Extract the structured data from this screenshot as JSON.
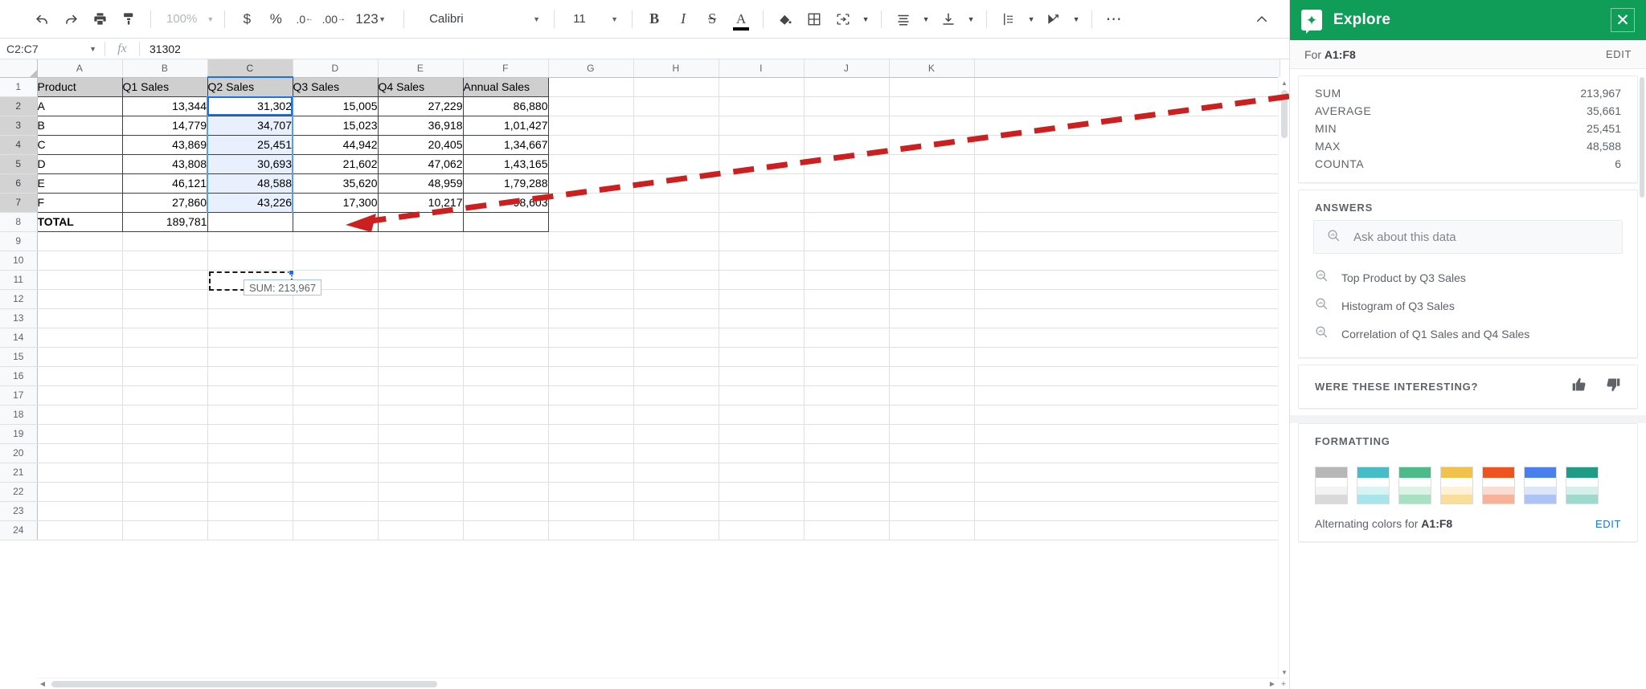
{
  "toolbar": {
    "zoom": "100%",
    "font": "Calibri",
    "font_size": "11",
    "currency_label": "$",
    "percent_label": "%",
    "dec_dec_label": ".0",
    "dec_inc_label": ".00",
    "numfmt_label": "123",
    "bold_label": "B",
    "italic_label": "I",
    "strike_label": "S",
    "textcolor_label": "A",
    "more_label": "⋯",
    "icons": [
      "undo-icon",
      "redo-icon",
      "print-icon",
      "paint-format-icon",
      "fill-color-icon",
      "borders-icon",
      "merge-cells-icon",
      "horizontal-align-icon",
      "vertical-align-icon",
      "text-wrap-icon",
      "text-rotation-icon",
      "collapse-toolbar-icon"
    ]
  },
  "formula_bar": {
    "name_box": "C2:C7",
    "fx": "fx",
    "value": "31302"
  },
  "grid": {
    "columns": [
      "A",
      "B",
      "C",
      "D",
      "E",
      "F",
      "G",
      "H",
      "I",
      "J",
      "K"
    ],
    "selected_column": "C",
    "rows": [
      1,
      2,
      3,
      4,
      5,
      6,
      7,
      8,
      9,
      10,
      11,
      12,
      13,
      14,
      15,
      16,
      17,
      18,
      19,
      20,
      21,
      22,
      23,
      24
    ],
    "selected_rows": [
      2,
      3,
      4,
      5,
      6,
      7
    ],
    "table": {
      "headers": [
        "Product",
        "Q1 Sales",
        "Q2 Sales",
        "Q3 Sales",
        "Q4 Sales",
        "Annual Sales"
      ],
      "rows": [
        [
          "A",
          "13,344",
          "31,302",
          "15,005",
          "27,229",
          "86,880"
        ],
        [
          "B",
          "14,779",
          "34,707",
          "15,023",
          "36,918",
          "1,01,427"
        ],
        [
          "C",
          "43,869",
          "25,451",
          "44,942",
          "20,405",
          "1,34,667"
        ],
        [
          "D",
          "43,808",
          "30,693",
          "21,602",
          "47,062",
          "1,43,165"
        ],
        [
          "E",
          "46,121",
          "48,588",
          "35,620",
          "48,959",
          "1,79,288"
        ],
        [
          "F",
          "27,860",
          "43,226",
          "17,300",
          "10,217",
          "98,603"
        ]
      ],
      "total_row": [
        "TOTAL",
        "189,781",
        "",
        "",
        "",
        ""
      ]
    },
    "sum_tooltip": "SUM: 213,967"
  },
  "explore": {
    "title": "Explore",
    "logo_icon": "explore-star-icon",
    "close_icon": "close-icon",
    "range_prefix": "For",
    "range": "A1:F8",
    "range_edit": "EDIT",
    "stats": [
      {
        "name": "SUM",
        "value": "213,967"
      },
      {
        "name": "AVERAGE",
        "value": "35,661"
      },
      {
        "name": "MIN",
        "value": "25,451"
      },
      {
        "name": "MAX",
        "value": "48,588"
      },
      {
        "name": "COUNTA",
        "value": "6"
      }
    ],
    "answers_title": "ANSWERS",
    "ask_placeholder": "Ask about this data",
    "suggestions": [
      "Top Product by Q3 Sales",
      "Histogram of Q3 Sales",
      "Correlation of Q1 Sales and Q4 Sales"
    ],
    "feedback_label": "WERE THESE INTERESTING?",
    "thumb_up_icon": "thumb-up-icon",
    "thumb_down_icon": "thumb-down-icon",
    "formatting_title": "FORMATTING",
    "swatches": [
      {
        "name": "grey",
        "header": "#b7b7b7",
        "band": "#f3f3f3",
        "band2": "#d9d9d9"
      },
      {
        "name": "cyan",
        "header": "#46bdc6",
        "band": "#d9f2f4",
        "band2": "#a8e4e9"
      },
      {
        "name": "green",
        "header": "#4cbb87",
        "band": "#ddf2e7",
        "band2": "#a9dfc3"
      },
      {
        "name": "yellow",
        "header": "#f2c14b",
        "band": "#fdf2d5",
        "band2": "#f8dd9b"
      },
      {
        "name": "red",
        "header": "#ef5420",
        "band": "#fbdcd1",
        "band2": "#f8b29a"
      },
      {
        "name": "blue",
        "header": "#4a80ee",
        "band": "#dde5fa",
        "band2": "#adc3f6"
      },
      {
        "name": "teal",
        "header": "#1f9b86",
        "band": "#d7efe9",
        "band2": "#9fd9ce"
      }
    ],
    "alternating_prefix": "Alternating colors for",
    "alternating_range": "A1:F8",
    "alternating_edit": "EDIT",
    "brand_green": "#0f9d58"
  },
  "annotation": {
    "color": "#cc1f1f",
    "shape": "dashed-arrow"
  }
}
